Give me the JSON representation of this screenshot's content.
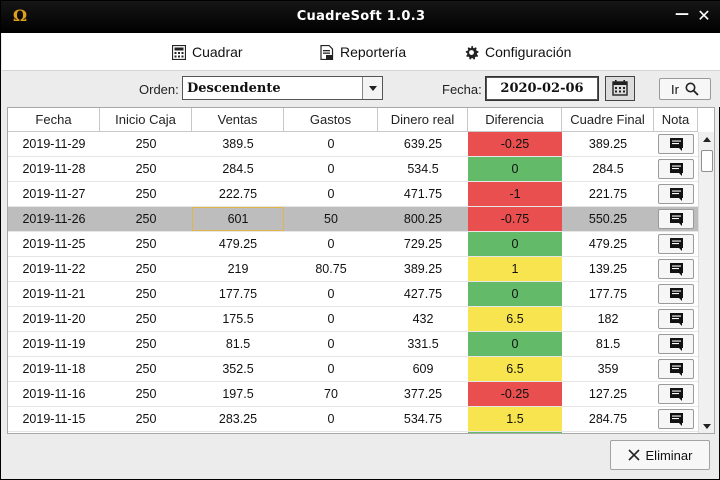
{
  "window": {
    "title": "CuadreSoft 1.0.3",
    "logo": "Ω",
    "minimize": "—",
    "close": "✕"
  },
  "menu": {
    "cuadrar": "Cuadrar",
    "reporteria": "Reportería",
    "configuracion": "Configuración"
  },
  "filters": {
    "orden_label": "Orden:",
    "orden_value": "Descendente",
    "fecha_label": "Fecha:",
    "fecha_value": "2020-02-06",
    "ir_label": "Ir"
  },
  "table": {
    "columns": [
      "Fecha",
      "Inicio Caja",
      "Ventas",
      "Gastos",
      "Dinero real",
      "Diferencia",
      "Cuadre Final",
      "Nota"
    ],
    "rows": [
      {
        "fecha": "2019-11-29",
        "inicio": "250",
        "ventas": "389.5",
        "gastos": "0",
        "dinero": "639.25",
        "diferencia": "-0.25",
        "status": "red",
        "final": "389.25"
      },
      {
        "fecha": "2019-11-28",
        "inicio": "250",
        "ventas": "284.5",
        "gastos": "0",
        "dinero": "534.5",
        "diferencia": "0",
        "status": "green",
        "final": "284.5"
      },
      {
        "fecha": "2019-11-27",
        "inicio": "250",
        "ventas": "222.75",
        "gastos": "0",
        "dinero": "471.75",
        "diferencia": "-1",
        "status": "red",
        "final": "221.75"
      },
      {
        "fecha": "2019-11-26",
        "inicio": "250",
        "ventas": "601",
        "gastos": "50",
        "dinero": "800.25",
        "diferencia": "-0.75",
        "status": "red",
        "final": "550.25",
        "selected": true
      },
      {
        "fecha": "2019-11-25",
        "inicio": "250",
        "ventas": "479.25",
        "gastos": "0",
        "dinero": "729.25",
        "diferencia": "0",
        "status": "green",
        "final": "479.25"
      },
      {
        "fecha": "2019-11-22",
        "inicio": "250",
        "ventas": "219",
        "gastos": "80.75",
        "dinero": "389.25",
        "diferencia": "1",
        "status": "yellow",
        "final": "139.25"
      },
      {
        "fecha": "2019-11-21",
        "inicio": "250",
        "ventas": "177.75",
        "gastos": "0",
        "dinero": "427.75",
        "diferencia": "0",
        "status": "green",
        "final": "177.75"
      },
      {
        "fecha": "2019-11-20",
        "inicio": "250",
        "ventas": "175.5",
        "gastos": "0",
        "dinero": "432",
        "diferencia": "6.5",
        "status": "yellow",
        "final": "182"
      },
      {
        "fecha": "2019-11-19",
        "inicio": "250",
        "ventas": "81.5",
        "gastos": "0",
        "dinero": "331.5",
        "diferencia": "0",
        "status": "green",
        "final": "81.5"
      },
      {
        "fecha": "2019-11-18",
        "inicio": "250",
        "ventas": "352.5",
        "gastos": "0",
        "dinero": "609",
        "diferencia": "6.5",
        "status": "yellow",
        "final": "359"
      },
      {
        "fecha": "2019-11-16",
        "inicio": "250",
        "ventas": "197.5",
        "gastos": "70",
        "dinero": "377.25",
        "diferencia": "-0.25",
        "status": "red",
        "final": "127.25"
      },
      {
        "fecha": "2019-11-15",
        "inicio": "250",
        "ventas": "283.25",
        "gastos": "0",
        "dinero": "534.75",
        "diferencia": "1.5",
        "status": "yellow",
        "final": "284.75"
      },
      {
        "fecha": "",
        "inicio": "",
        "ventas": "",
        "gastos": "",
        "dinero": "",
        "diferencia": "",
        "status": "green",
        "final": ""
      }
    ]
  },
  "actions": {
    "eliminar": "Eliminar"
  },
  "colors": {
    "red": "#ea4f4f",
    "green": "#63bb6a",
    "yellow": "#f7e44f",
    "selected_row": "#bdbdbd"
  },
  "icons": {
    "cuadrar": "calculator-icon",
    "reporteria": "report-icon",
    "configuracion": "gear-icon",
    "calendar": "calendar-icon",
    "ir": "search-icon",
    "nota": "note-icon",
    "eliminar": "close-icon"
  }
}
